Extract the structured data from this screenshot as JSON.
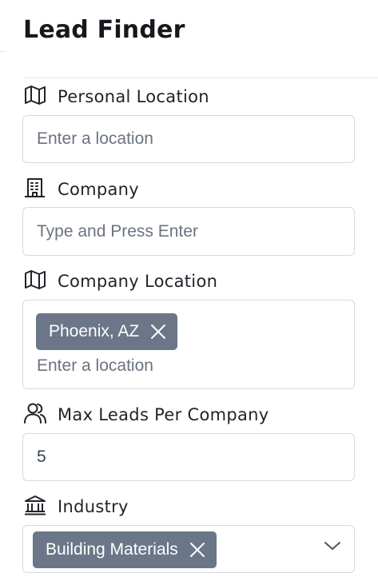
{
  "header": {
    "title": "Lead Finder"
  },
  "form": {
    "personal_location": {
      "label": "Personal Location",
      "icon": "map-icon",
      "placeholder": "Enter a location",
      "value": ""
    },
    "company": {
      "label": "Company",
      "icon": "building-icon",
      "placeholder": "Type and Press Enter",
      "value": ""
    },
    "company_location": {
      "label": "Company Location",
      "icon": "map-icon",
      "tags": [
        "Phoenix, AZ"
      ],
      "placeholder": "Enter a location",
      "value": ""
    },
    "max_leads": {
      "label": "Max Leads Per Company",
      "icon": "users-icon",
      "value": "5"
    },
    "industry": {
      "label": "Industry",
      "icon": "bank-icon",
      "tags": [
        "Building Materials"
      ]
    }
  },
  "colors": {
    "tag_bg": "#6b7689",
    "border": "#d6d9de",
    "text": "#1f2328"
  }
}
